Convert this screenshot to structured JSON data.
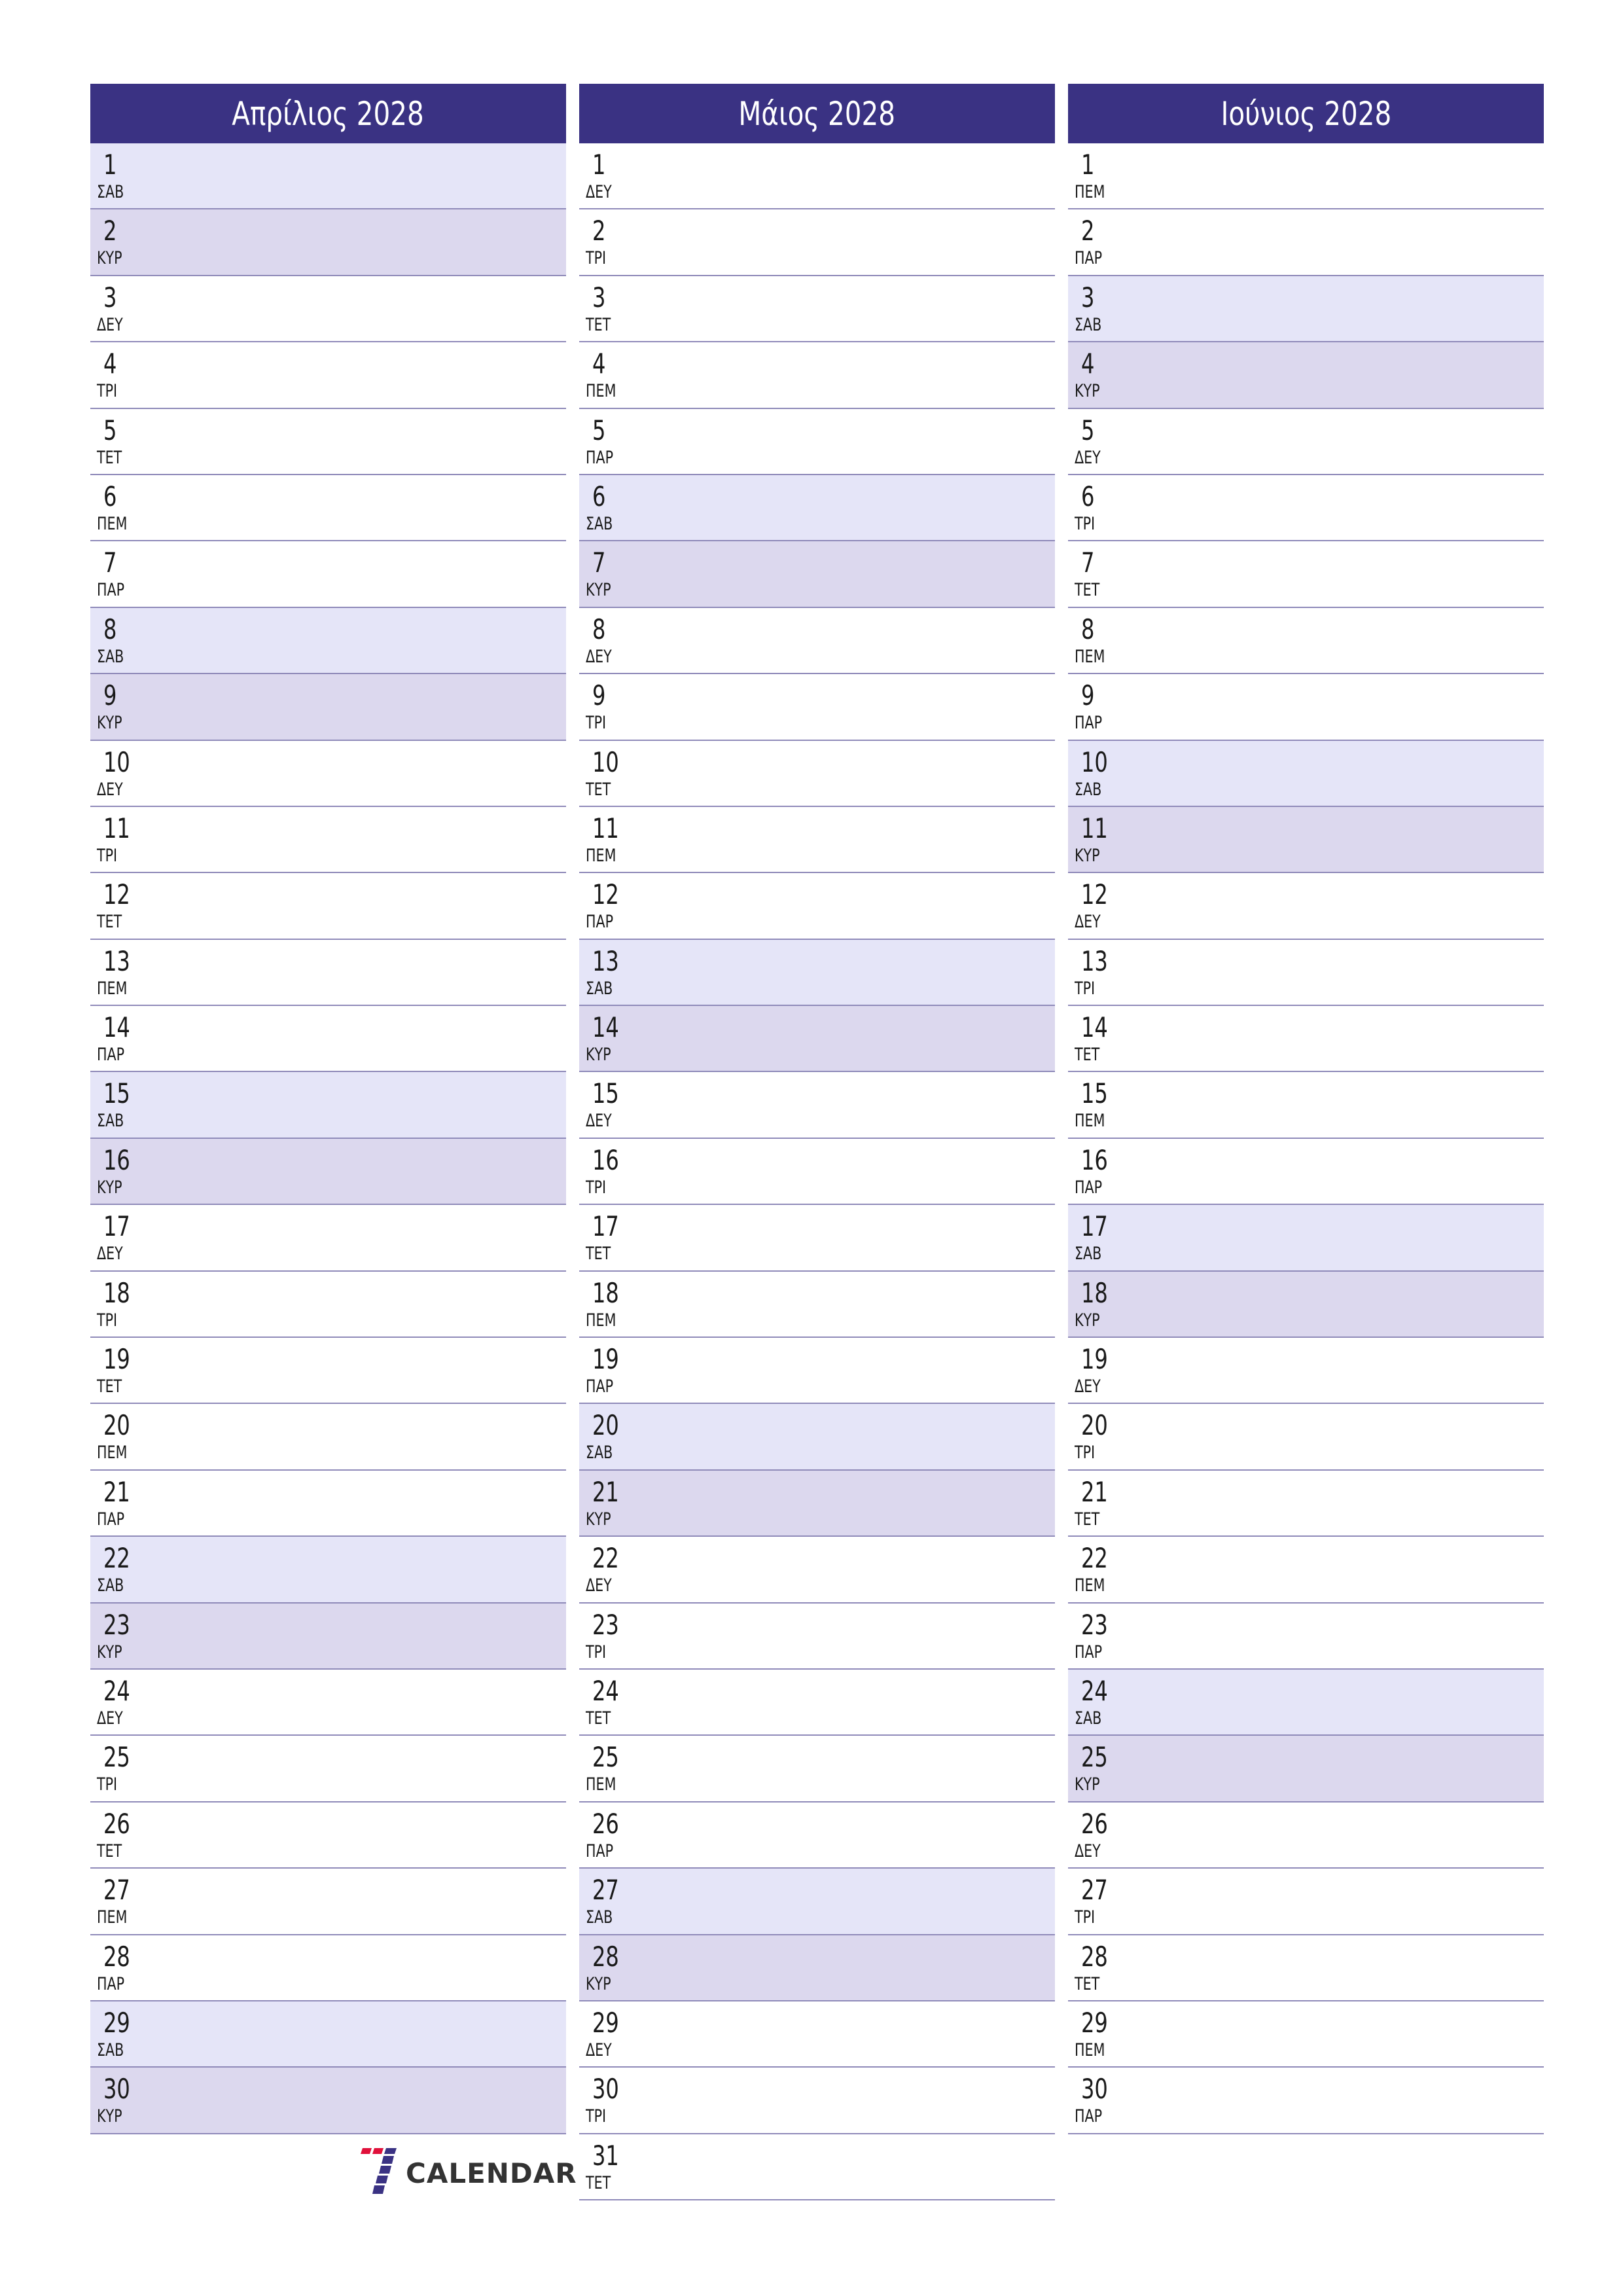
{
  "colors": {
    "header_bg": "#3a3283",
    "saturday_bg": "#e5e5f8",
    "sunday_bg": "#dcd8ee",
    "divider": "#8f8ab9",
    "logo_red": "#e0103a",
    "logo_blue": "#3a3283"
  },
  "months": [
    {
      "title": "Απρίλιος 2028",
      "days": [
        {
          "n": "1",
          "d": "ΣΑΒ",
          "t": "sat"
        },
        {
          "n": "2",
          "d": "ΚΥΡ",
          "t": "sun"
        },
        {
          "n": "3",
          "d": "ΔΕΥ",
          "t": ""
        },
        {
          "n": "4",
          "d": "ΤΡΙ",
          "t": ""
        },
        {
          "n": "5",
          "d": "ΤΕΤ",
          "t": ""
        },
        {
          "n": "6",
          "d": "ΠΕΜ",
          "t": ""
        },
        {
          "n": "7",
          "d": "ΠΑΡ",
          "t": ""
        },
        {
          "n": "8",
          "d": "ΣΑΒ",
          "t": "sat"
        },
        {
          "n": "9",
          "d": "ΚΥΡ",
          "t": "sun"
        },
        {
          "n": "10",
          "d": "ΔΕΥ",
          "t": ""
        },
        {
          "n": "11",
          "d": "ΤΡΙ",
          "t": ""
        },
        {
          "n": "12",
          "d": "ΤΕΤ",
          "t": ""
        },
        {
          "n": "13",
          "d": "ΠΕΜ",
          "t": ""
        },
        {
          "n": "14",
          "d": "ΠΑΡ",
          "t": ""
        },
        {
          "n": "15",
          "d": "ΣΑΒ",
          "t": "sat"
        },
        {
          "n": "16",
          "d": "ΚΥΡ",
          "t": "sun"
        },
        {
          "n": "17",
          "d": "ΔΕΥ",
          "t": ""
        },
        {
          "n": "18",
          "d": "ΤΡΙ",
          "t": ""
        },
        {
          "n": "19",
          "d": "ΤΕΤ",
          "t": ""
        },
        {
          "n": "20",
          "d": "ΠΕΜ",
          "t": ""
        },
        {
          "n": "21",
          "d": "ΠΑΡ",
          "t": ""
        },
        {
          "n": "22",
          "d": "ΣΑΒ",
          "t": "sat"
        },
        {
          "n": "23",
          "d": "ΚΥΡ",
          "t": "sun"
        },
        {
          "n": "24",
          "d": "ΔΕΥ",
          "t": ""
        },
        {
          "n": "25",
          "d": "ΤΡΙ",
          "t": ""
        },
        {
          "n": "26",
          "d": "ΤΕΤ",
          "t": ""
        },
        {
          "n": "27",
          "d": "ΠΕΜ",
          "t": ""
        },
        {
          "n": "28",
          "d": "ΠΑΡ",
          "t": ""
        },
        {
          "n": "29",
          "d": "ΣΑΒ",
          "t": "sat"
        },
        {
          "n": "30",
          "d": "ΚΥΡ",
          "t": "sun"
        }
      ]
    },
    {
      "title": "Μάιος 2028",
      "days": [
        {
          "n": "1",
          "d": "ΔΕΥ",
          "t": ""
        },
        {
          "n": "2",
          "d": "ΤΡΙ",
          "t": ""
        },
        {
          "n": "3",
          "d": "ΤΕΤ",
          "t": ""
        },
        {
          "n": "4",
          "d": "ΠΕΜ",
          "t": ""
        },
        {
          "n": "5",
          "d": "ΠΑΡ",
          "t": ""
        },
        {
          "n": "6",
          "d": "ΣΑΒ",
          "t": "sat"
        },
        {
          "n": "7",
          "d": "ΚΥΡ",
          "t": "sun"
        },
        {
          "n": "8",
          "d": "ΔΕΥ",
          "t": ""
        },
        {
          "n": "9",
          "d": "ΤΡΙ",
          "t": ""
        },
        {
          "n": "10",
          "d": "ΤΕΤ",
          "t": ""
        },
        {
          "n": "11",
          "d": "ΠΕΜ",
          "t": ""
        },
        {
          "n": "12",
          "d": "ΠΑΡ",
          "t": ""
        },
        {
          "n": "13",
          "d": "ΣΑΒ",
          "t": "sat"
        },
        {
          "n": "14",
          "d": "ΚΥΡ",
          "t": "sun"
        },
        {
          "n": "15",
          "d": "ΔΕΥ",
          "t": ""
        },
        {
          "n": "16",
          "d": "ΤΡΙ",
          "t": ""
        },
        {
          "n": "17",
          "d": "ΤΕΤ",
          "t": ""
        },
        {
          "n": "18",
          "d": "ΠΕΜ",
          "t": ""
        },
        {
          "n": "19",
          "d": "ΠΑΡ",
          "t": ""
        },
        {
          "n": "20",
          "d": "ΣΑΒ",
          "t": "sat"
        },
        {
          "n": "21",
          "d": "ΚΥΡ",
          "t": "sun"
        },
        {
          "n": "22",
          "d": "ΔΕΥ",
          "t": ""
        },
        {
          "n": "23",
          "d": "ΤΡΙ",
          "t": ""
        },
        {
          "n": "24",
          "d": "ΤΕΤ",
          "t": ""
        },
        {
          "n": "25",
          "d": "ΠΕΜ",
          "t": ""
        },
        {
          "n": "26",
          "d": "ΠΑΡ",
          "t": ""
        },
        {
          "n": "27",
          "d": "ΣΑΒ",
          "t": "sat"
        },
        {
          "n": "28",
          "d": "ΚΥΡ",
          "t": "sun"
        },
        {
          "n": "29",
          "d": "ΔΕΥ",
          "t": ""
        },
        {
          "n": "30",
          "d": "ΤΡΙ",
          "t": ""
        },
        {
          "n": "31",
          "d": "ΤΕΤ",
          "t": ""
        }
      ]
    },
    {
      "title": "Ιούνιος 2028",
      "days": [
        {
          "n": "1",
          "d": "ΠΕΜ",
          "t": ""
        },
        {
          "n": "2",
          "d": "ΠΑΡ",
          "t": ""
        },
        {
          "n": "3",
          "d": "ΣΑΒ",
          "t": "sat"
        },
        {
          "n": "4",
          "d": "ΚΥΡ",
          "t": "sun"
        },
        {
          "n": "5",
          "d": "ΔΕΥ",
          "t": ""
        },
        {
          "n": "6",
          "d": "ΤΡΙ",
          "t": ""
        },
        {
          "n": "7",
          "d": "ΤΕΤ",
          "t": ""
        },
        {
          "n": "8",
          "d": "ΠΕΜ",
          "t": ""
        },
        {
          "n": "9",
          "d": "ΠΑΡ",
          "t": ""
        },
        {
          "n": "10",
          "d": "ΣΑΒ",
          "t": "sat"
        },
        {
          "n": "11",
          "d": "ΚΥΡ",
          "t": "sun"
        },
        {
          "n": "12",
          "d": "ΔΕΥ",
          "t": ""
        },
        {
          "n": "13",
          "d": "ΤΡΙ",
          "t": ""
        },
        {
          "n": "14",
          "d": "ΤΕΤ",
          "t": ""
        },
        {
          "n": "15",
          "d": "ΠΕΜ",
          "t": ""
        },
        {
          "n": "16",
          "d": "ΠΑΡ",
          "t": ""
        },
        {
          "n": "17",
          "d": "ΣΑΒ",
          "t": "sat"
        },
        {
          "n": "18",
          "d": "ΚΥΡ",
          "t": "sun"
        },
        {
          "n": "19",
          "d": "ΔΕΥ",
          "t": ""
        },
        {
          "n": "20",
          "d": "ΤΡΙ",
          "t": ""
        },
        {
          "n": "21",
          "d": "ΤΕΤ",
          "t": ""
        },
        {
          "n": "22",
          "d": "ΠΕΜ",
          "t": ""
        },
        {
          "n": "23",
          "d": "ΠΑΡ",
          "t": ""
        },
        {
          "n": "24",
          "d": "ΣΑΒ",
          "t": "sat"
        },
        {
          "n": "25",
          "d": "ΚΥΡ",
          "t": "sun"
        },
        {
          "n": "26",
          "d": "ΔΕΥ",
          "t": ""
        },
        {
          "n": "27",
          "d": "ΤΡΙ",
          "t": ""
        },
        {
          "n": "28",
          "d": "ΤΕΤ",
          "t": ""
        },
        {
          "n": "29",
          "d": "ΠΕΜ",
          "t": ""
        },
        {
          "n": "30",
          "d": "ΠΑΡ",
          "t": ""
        }
      ]
    }
  ],
  "logo": {
    "icon": "seven-logo-icon",
    "text": "CALENDAR"
  }
}
